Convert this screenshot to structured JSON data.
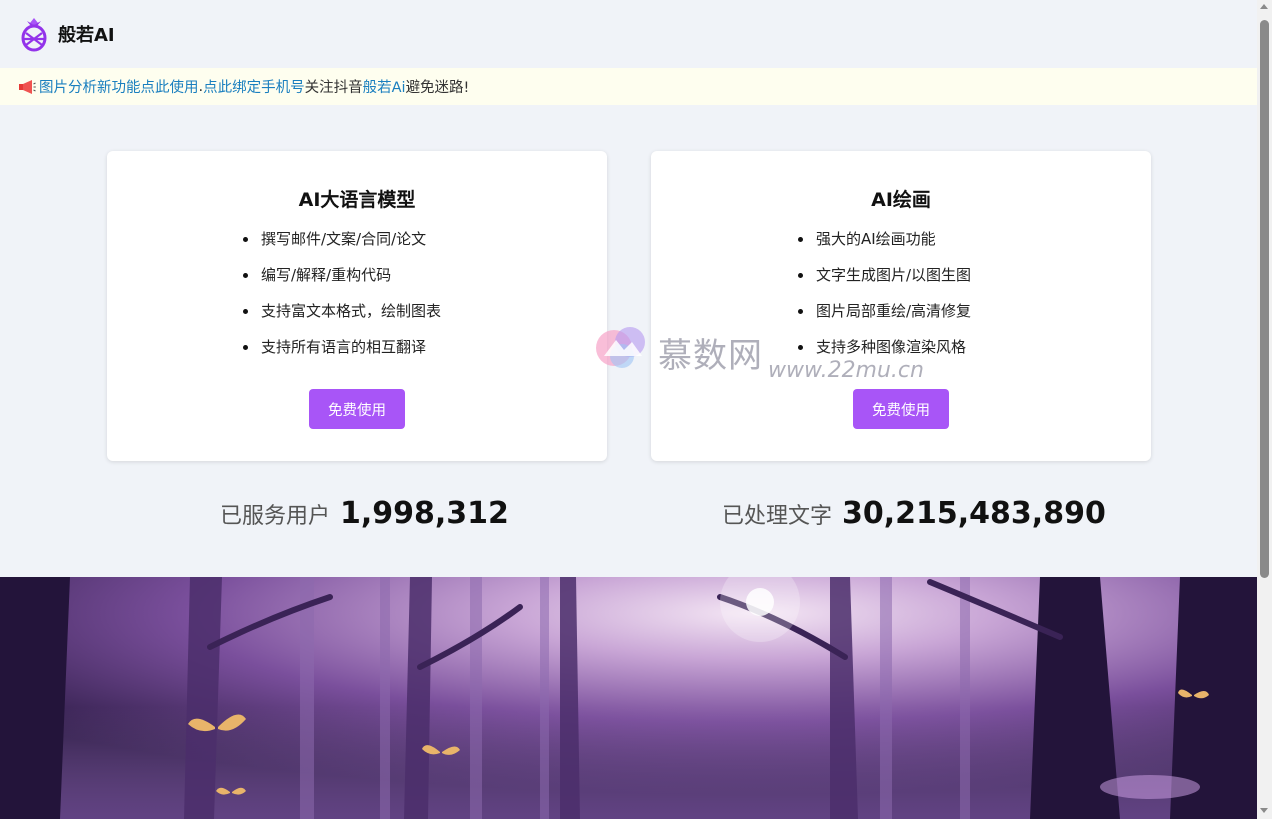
{
  "header": {
    "brand": "般若AI",
    "logo_icon": "pineapple-logo-icon",
    "accent": "#a855f7"
  },
  "notice": {
    "icon": "megaphone-icon",
    "link1": "图片分析新功能点此使用",
    "sep": ". ",
    "link2": "点此绑定手机号",
    "text1": "关注抖音",
    "link3": "般若Ai",
    "text2": "避免迷路!",
    "link_color": "#1a7fbf"
  },
  "cards": [
    {
      "title": "AI大语言模型",
      "features": [
        "撰写邮件/文案/合同/论文",
        "编写/解释/重构代码",
        "支持富文本格式，绘制图表",
        "支持所有语言的相互翻译"
      ],
      "button": "免费使用"
    },
    {
      "title": "AI绘画",
      "features": [
        "强大的AI绘画功能",
        "文字生成图片/以图生图",
        "图片局部重绘/高清修复",
        "支持多种图像渲染风格"
      ],
      "button": "免费使用"
    }
  ],
  "stats": [
    {
      "label": "已服务用户",
      "value": "1,998,312"
    },
    {
      "label": "已处理文字",
      "value": "30,215,483,890"
    }
  ],
  "watermark": {
    "text": "慕数网",
    "url": "www.22mu.cn"
  },
  "banner": {
    "icon": "forest-butterflies-illustration"
  }
}
